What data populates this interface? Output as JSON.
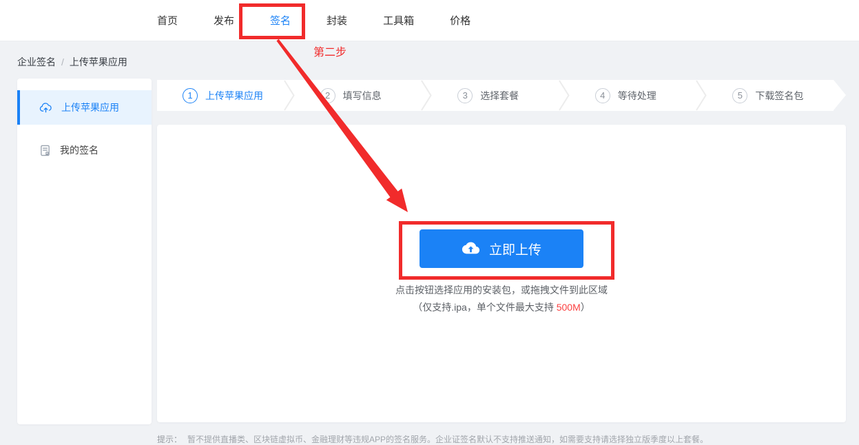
{
  "colors": {
    "accent": "#1b82f6",
    "accent_bg": "#e8f3fe",
    "annotation_red": "#f12b2b",
    "file_limit_red": "#fb4040",
    "page_bg": "#f0f2f5"
  },
  "nav": {
    "items": [
      {
        "label": "首页"
      },
      {
        "label": "发布"
      },
      {
        "label": "签名"
      },
      {
        "label": "封装"
      },
      {
        "label": "工具箱"
      },
      {
        "label": "价格"
      }
    ]
  },
  "annotation": {
    "step_label": "第二步"
  },
  "breadcrumb": {
    "root": "企业签名",
    "separator": "/",
    "current": "上传苹果应用"
  },
  "sidebar": {
    "items": [
      {
        "label": "上传苹果应用"
      },
      {
        "label": "我的签名"
      }
    ]
  },
  "steps": {
    "items": [
      {
        "num": "1",
        "label": "上传苹果应用"
      },
      {
        "num": "2",
        "label": "填写信息"
      },
      {
        "num": "3",
        "label": "选择套餐"
      },
      {
        "num": "4",
        "label": "等待处理"
      },
      {
        "num": "5",
        "label": "下载签名包"
      }
    ]
  },
  "upload": {
    "button_label": "立即上传",
    "hint_line1": "点击按钮选择应用的安装包，或拖拽文件到此区域",
    "hint_line2_prefix": "（仅支持.ipa，单个文件最大支持 ",
    "hint_line2_highlight": "500M",
    "hint_line2_suffix": "）"
  },
  "footer": {
    "tip_label": "提示：",
    "tip_text": "暂不提供直播类、区块链虚拟币、金融理财等违规APP的签名服务。企业证签名默认不支持推送通知，如需要支持请选择独立版季度以上套餐。"
  }
}
